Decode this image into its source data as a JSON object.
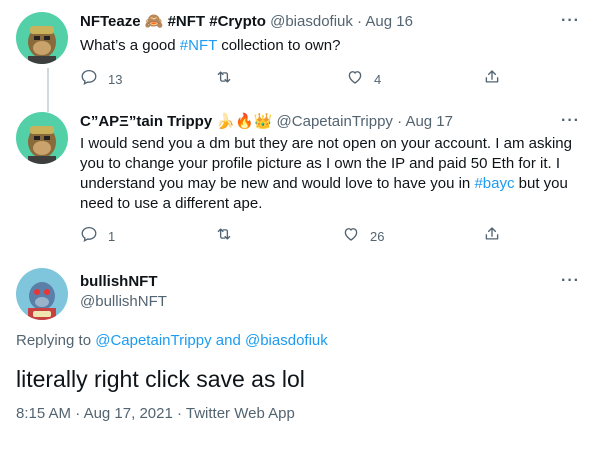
{
  "tweets": [
    {
      "name": "NFTeaze 🙈 #NFT #Crypto",
      "handle": "@biasdofiuk",
      "date": "Aug 16",
      "text_before": "What’s a good ",
      "hashtag": "#NFT",
      "text_after": " collection to own?",
      "replies": "13",
      "retweets": "",
      "likes": "4"
    },
    {
      "name": "C”APΞ”tain Trippy 🍌🔥👑",
      "handle": "@CapetainTrippy",
      "date": "Aug 17",
      "text_before": "I would send you a dm but they are not open on your account. I am asking you to change your profile picture as I own the IP and paid 50 Eth for it. I understand you may be new and would love to have you in ",
      "hashtag": "#bayc",
      "text_after": " but you need to use a different ape.",
      "replies": "1",
      "retweets": "",
      "likes": "26"
    }
  ],
  "main": {
    "name": "bullishNFT",
    "handle": "@bullishNFT",
    "replying_label": "Replying to ",
    "replying_user1": "@CapetainTrippy",
    "replying_and": " and ",
    "replying_user2": "@biasdofiuk",
    "text": "literally right click save as lol",
    "time": "8:15 AM",
    "date": "Aug 17, 2021",
    "source": "Twitter Web App",
    "separator": " · "
  },
  "more_glyph": "···",
  "dot": " · ",
  "colors": {
    "link": "#1d9bf0",
    "secondary": "#536471",
    "line": "#cfd9de"
  },
  "icons": [
    "reply-icon",
    "retweet-icon",
    "like-icon",
    "share-icon",
    "more-icon"
  ]
}
